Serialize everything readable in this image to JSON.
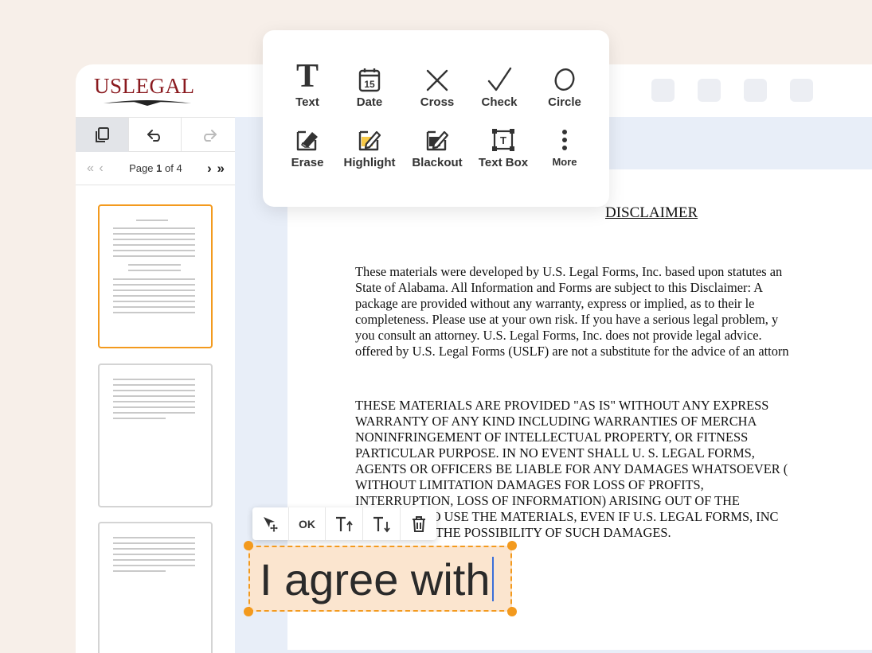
{
  "logo": {
    "text": "USLEGAL"
  },
  "sidebar": {
    "pager": {
      "prefix": "Page",
      "current": "1",
      "suffix": "of 4"
    }
  },
  "tools": [
    {
      "label": "Text",
      "icon": "text-icon"
    },
    {
      "label": "Date",
      "icon": "calendar-icon",
      "day": "15"
    },
    {
      "label": "Cross",
      "icon": "cross-icon"
    },
    {
      "label": "Check",
      "icon": "check-icon"
    },
    {
      "label": "Circle",
      "icon": "circle-icon"
    },
    {
      "label": "Erase",
      "icon": "erase-icon"
    },
    {
      "label": "Highlight",
      "icon": "highlight-icon"
    },
    {
      "label": "Blackout",
      "icon": "blackout-icon"
    },
    {
      "label": "Text Box",
      "icon": "text-box-icon"
    },
    {
      "label": "More",
      "icon": "more-icon"
    }
  ],
  "document": {
    "title": "DISCLAIMER",
    "para1": [
      "These materials were developed by U.S. Legal Forms, Inc. based upon statutes an",
      "State of Alabama.  All Information and Forms are subject to this Disclaimer: A",
      "package are provided without any warranty, express or implied, as to their le",
      "completeness.  Please use at your own risk.  If you have a serious legal problem, y",
      "you consult an attorney.  U.S. Legal Forms, Inc. does not provide legal advice.",
      "offered by U.S. Legal Forms (USLF) are not a substitute for the advice of an attorn"
    ],
    "para2": [
      "THESE MATERIALS ARE PROVIDED \"AS IS\" WITHOUT ANY EXPRESS",
      "WARRANTY OF ANY KIND INCLUDING WARRANTIES OF MERCHA",
      "NONINFRINGEMENT OF INTELLECTUAL PROPERTY, OR FITNESS",
      "PARTICULAR PURPOSE.  IN NO EVENT SHALL U. S. LEGAL FORMS,",
      "AGENTS OR OFFICERS BE LIABLE FOR ANY DAMAGES WHATSOEVER (",
      "WITHOUT  LIMITATION  DAMAGES  FOR  LOSS  OF  PROFITS,",
      "INTERRUPTION, LOSS OF INFORMATION) ARISING OUT OF THE",
      "INABILITY TO USE THE MATERIALS, EVEN IF U.S. LEGAL FORMS, INC",
      "ADVISED OF THE POSSIBILITY OF SUCH DAMAGES."
    ]
  },
  "text_toolbar": {
    "ok_label": "OK"
  },
  "text_box": {
    "value": "I agree with"
  },
  "colors": {
    "accent": "#f39a1e",
    "brand": "#8a1a1f",
    "textbox_fill": "#fbe5cf",
    "canvas_bg": "#e8eef8"
  }
}
